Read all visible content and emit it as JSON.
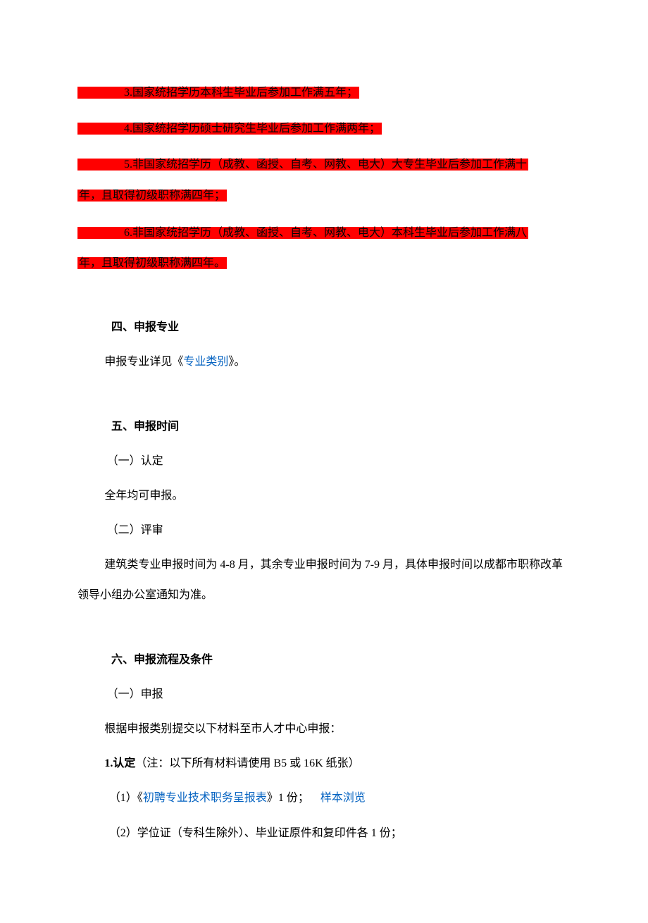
{
  "highlighted": {
    "item3": "3.国家统招学历本科生毕业后参加工作满五年；",
    "item4": "4.国家统招学历硕士研究生毕业后参加工作满两年；",
    "item5_a": "5.非国家统招学历（成教、函授、自考、网教、电大）大专生毕业后参加工作满十",
    "item5_b": "年，且取得初级职称满四年；",
    "item6_a": "6.非国家统招学历（成教、函授、自考、网教、电大）本科生毕业后参加工作满八",
    "item6_b": "年，且取得初级职称满四年。"
  },
  "section4": {
    "heading": "四、申报专业",
    "text_prefix": "申报专业详见《",
    "link": "专业类别",
    "text_suffix": "》。"
  },
  "section5": {
    "heading": "五、申报时间",
    "sub1": "（一）认定",
    "sub1_text": "全年均可申报。",
    "sub2": "（二）评审",
    "sub2_text": "建筑类专业申报时间为 4-8 月，其余专业申报时间为 7-9 月，具体申报时间以成都市职称改革领导小组办公室通知为准。"
  },
  "section6": {
    "heading": "六、申报流程及条件",
    "sub1": "（一）申报",
    "sub1_text": "根据申报类别提交以下材料至市人才中心申报：",
    "item1_bold": "1.认定",
    "item1_rest": "（注：以下所有材料请使用 B5 或 16K 纸张）",
    "item1_1_prefix": "（1）《",
    "item1_1_link": "初聘专业技术职务呈报表",
    "item1_1_mid": "》1 份；",
    "item1_1_sample": "样本浏览",
    "item1_2": "（2）学位证（专科生除外）、毕业证原件和复印件各 1 份；"
  }
}
